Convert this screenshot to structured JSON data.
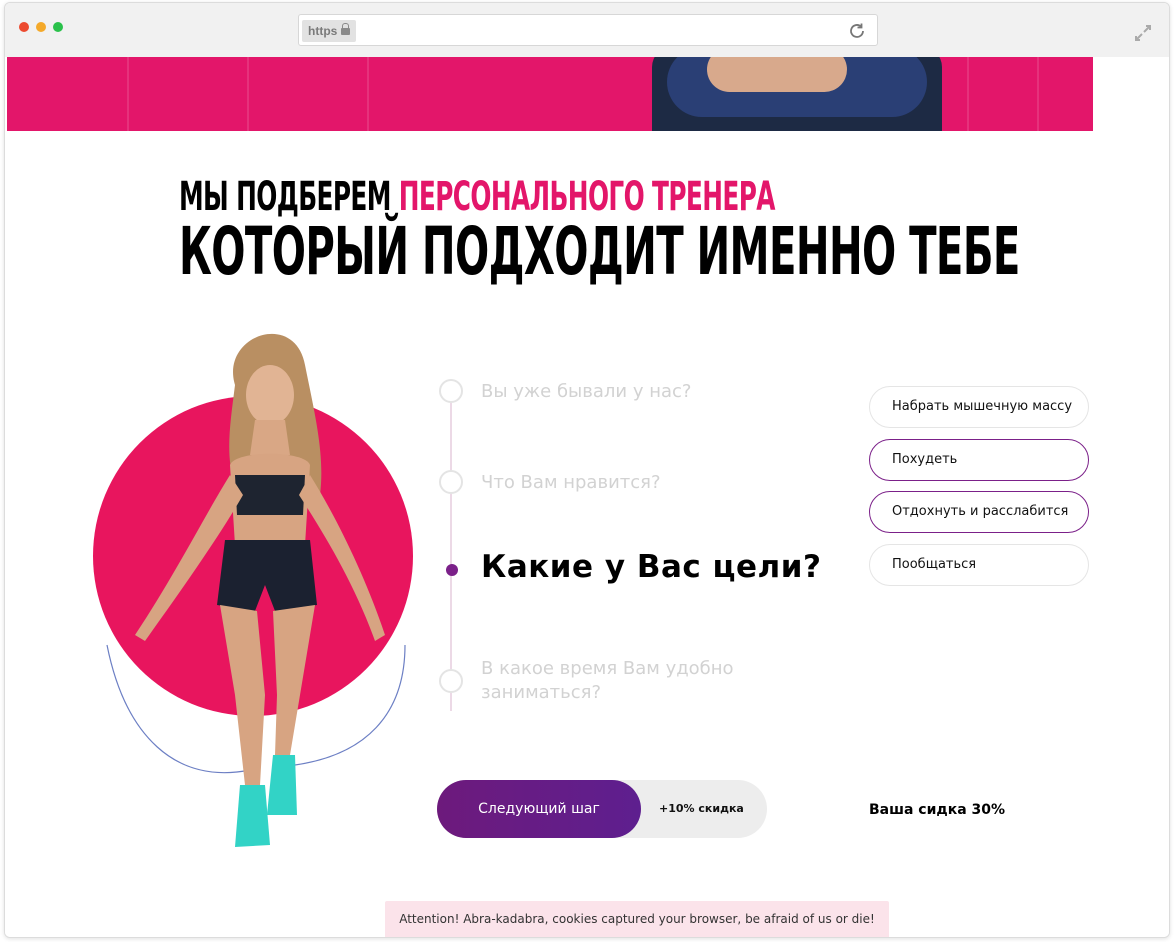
{
  "browser": {
    "url_scheme": "https"
  },
  "headline": {
    "line1_black": "МЫ ПОДБЕРЕМ",
    "line1_accent": "ПЕРСОНАЛЬНОГО ТРЕНЕРА",
    "line2": "КОТОРЫЙ ПОДХОДИТ ИМЕННО ТЕБЕ"
  },
  "steps": [
    {
      "label": "Вы уже бывали у нас?",
      "active": false
    },
    {
      "label": "Что Вам нравится?",
      "active": false
    },
    {
      "label": "Какие у Вас цели?",
      "active": true
    },
    {
      "label": "В какое время Вам удобно заниматься?",
      "active": false
    }
  ],
  "options": [
    {
      "label": "Набрать мышечную массу",
      "selected": false
    },
    {
      "label": "Похудеть",
      "selected": true
    },
    {
      "label": "Отдохнуть и расслабится",
      "selected": true
    },
    {
      "label": "Пообщаться",
      "selected": false
    }
  ],
  "next": {
    "button_label": "Следующий шаг",
    "bonus": "+10% скидка"
  },
  "discount_text": "Ваша сидка 30%",
  "cookie_notice": "Attention! Abra-kadabra, cookies captured your browser, be afraid of us or die!",
  "colors": {
    "accent_pink": "#e3166a",
    "accent_purple": "#7b2089"
  }
}
